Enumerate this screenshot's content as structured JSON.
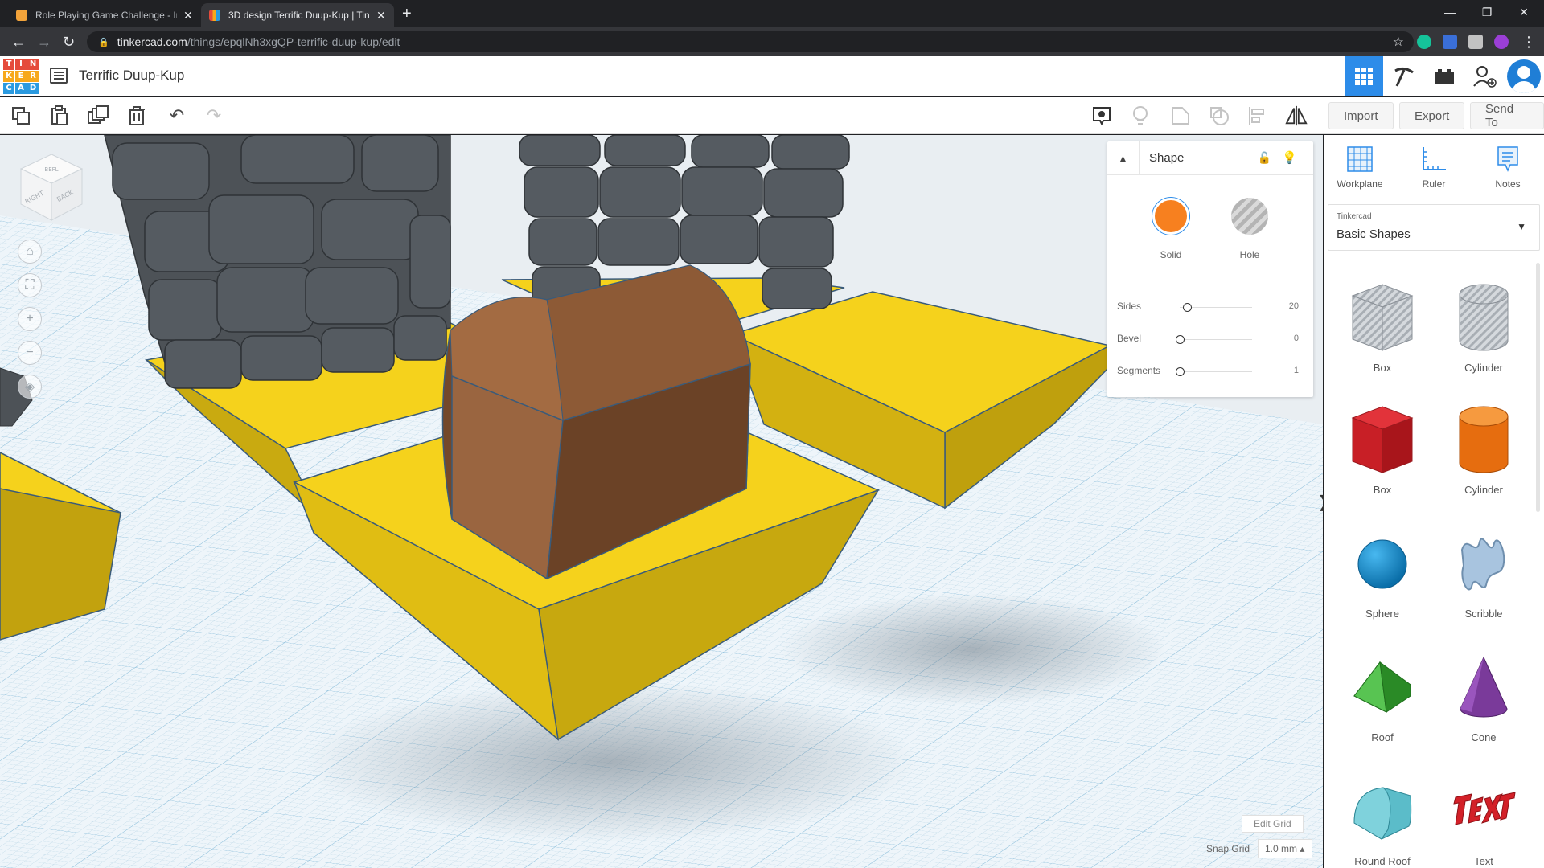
{
  "browser": {
    "tabs": [
      {
        "title": "Role Playing Game Challenge - In",
        "active": false
      },
      {
        "title": "3D design Terrific Duup-Kup | Tin",
        "active": true
      }
    ],
    "url_host": "tinkercad.com",
    "url_path": "/things/epqlNh3xgQP-terrific-duup-kup/edit"
  },
  "header": {
    "logo_letters": [
      "T",
      "I",
      "N",
      "K",
      "E",
      "R",
      "C",
      "A",
      "D"
    ],
    "design_title": "Terrific Duup-Kup"
  },
  "toolbar": {
    "import_label": "Import",
    "export_label": "Export",
    "send_to_label": "Send To"
  },
  "viewcube": {
    "top": "BEFL",
    "right": "RIGHT",
    "back": "BACK"
  },
  "inspector": {
    "title": "Shape",
    "solid_label": "Solid",
    "hole_label": "Hole",
    "props": [
      {
        "label": "Sides",
        "value": "20",
        "fraction": 0.1
      },
      {
        "label": "Bevel",
        "value": "0",
        "fraction": 0.0
      },
      {
        "label": "Segments",
        "value": "1",
        "fraction": 0.0
      }
    ]
  },
  "grid": {
    "edit_label": "Edit Grid",
    "snap_label": "Snap Grid",
    "snap_value": "1.0 mm ▴"
  },
  "panel": {
    "tools": [
      {
        "label": "Workplane",
        "icon": "workplane-icon"
      },
      {
        "label": "Ruler",
        "icon": "ruler-icon"
      },
      {
        "label": "Notes",
        "icon": "notes-icon"
      }
    ],
    "library_category": "Tinkercad",
    "library_name": "Basic Shapes",
    "shapes": [
      {
        "label": "Box",
        "kind": "hole-box"
      },
      {
        "label": "Cylinder",
        "kind": "hole-cylinder"
      },
      {
        "label": "Box",
        "kind": "box"
      },
      {
        "label": "Cylinder",
        "kind": "cylinder"
      },
      {
        "label": "Sphere",
        "kind": "sphere"
      },
      {
        "label": "Scribble",
        "kind": "scribble"
      },
      {
        "label": "Roof",
        "kind": "roof"
      },
      {
        "label": "Cone",
        "kind": "cone"
      },
      {
        "label": "Round Roof",
        "kind": "round-roof"
      },
      {
        "label": "Text",
        "kind": "text"
      }
    ]
  },
  "colors": {
    "solid": "#f7801f",
    "accent": "#2d8ce9",
    "platform": "#f5d21c",
    "chest": "#8d5a36",
    "stone": "#4d5257"
  }
}
